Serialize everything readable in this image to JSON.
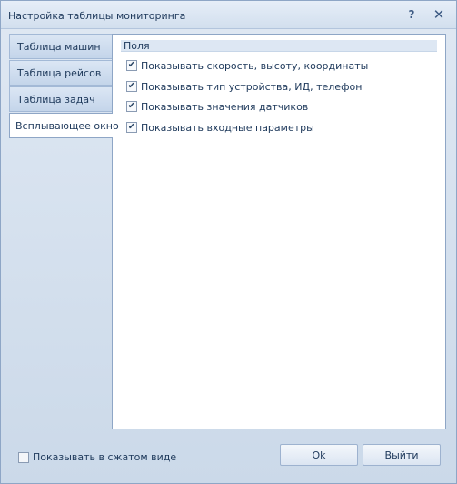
{
  "window": {
    "title": "Настройка таблицы мониторинга",
    "help_glyph": "?",
    "close_glyph": "✕"
  },
  "tabs": [
    {
      "label": "Таблица машин",
      "active": false
    },
    {
      "label": "Таблица рейсов",
      "active": false
    },
    {
      "label": "Таблица задач",
      "active": false
    },
    {
      "label": "Всплывающее окно",
      "active": true
    }
  ],
  "panel": {
    "group_header": "Поля",
    "options": [
      {
        "label": "Показывать скорость, высоту, координаты",
        "checked": true
      },
      {
        "label": "Показывать тип устройства, ИД, телефон",
        "checked": true
      },
      {
        "label": "Показывать значения датчиков",
        "checked": true
      },
      {
        "label": "Показывать входные параметры",
        "checked": true
      }
    ]
  },
  "footer": {
    "compact_label": "Показывать в сжатом виде",
    "compact_checked": false,
    "ok_label": "Ok",
    "exit_label": "Выйти"
  },
  "icons": {
    "checkmark": "✔",
    "help": "help-icon",
    "close": "close-icon"
  },
  "colors": {
    "frame": "#cbd9e9",
    "border": "#8ea6c6",
    "text": "#1e395b",
    "header_band": "#dde7f3"
  }
}
